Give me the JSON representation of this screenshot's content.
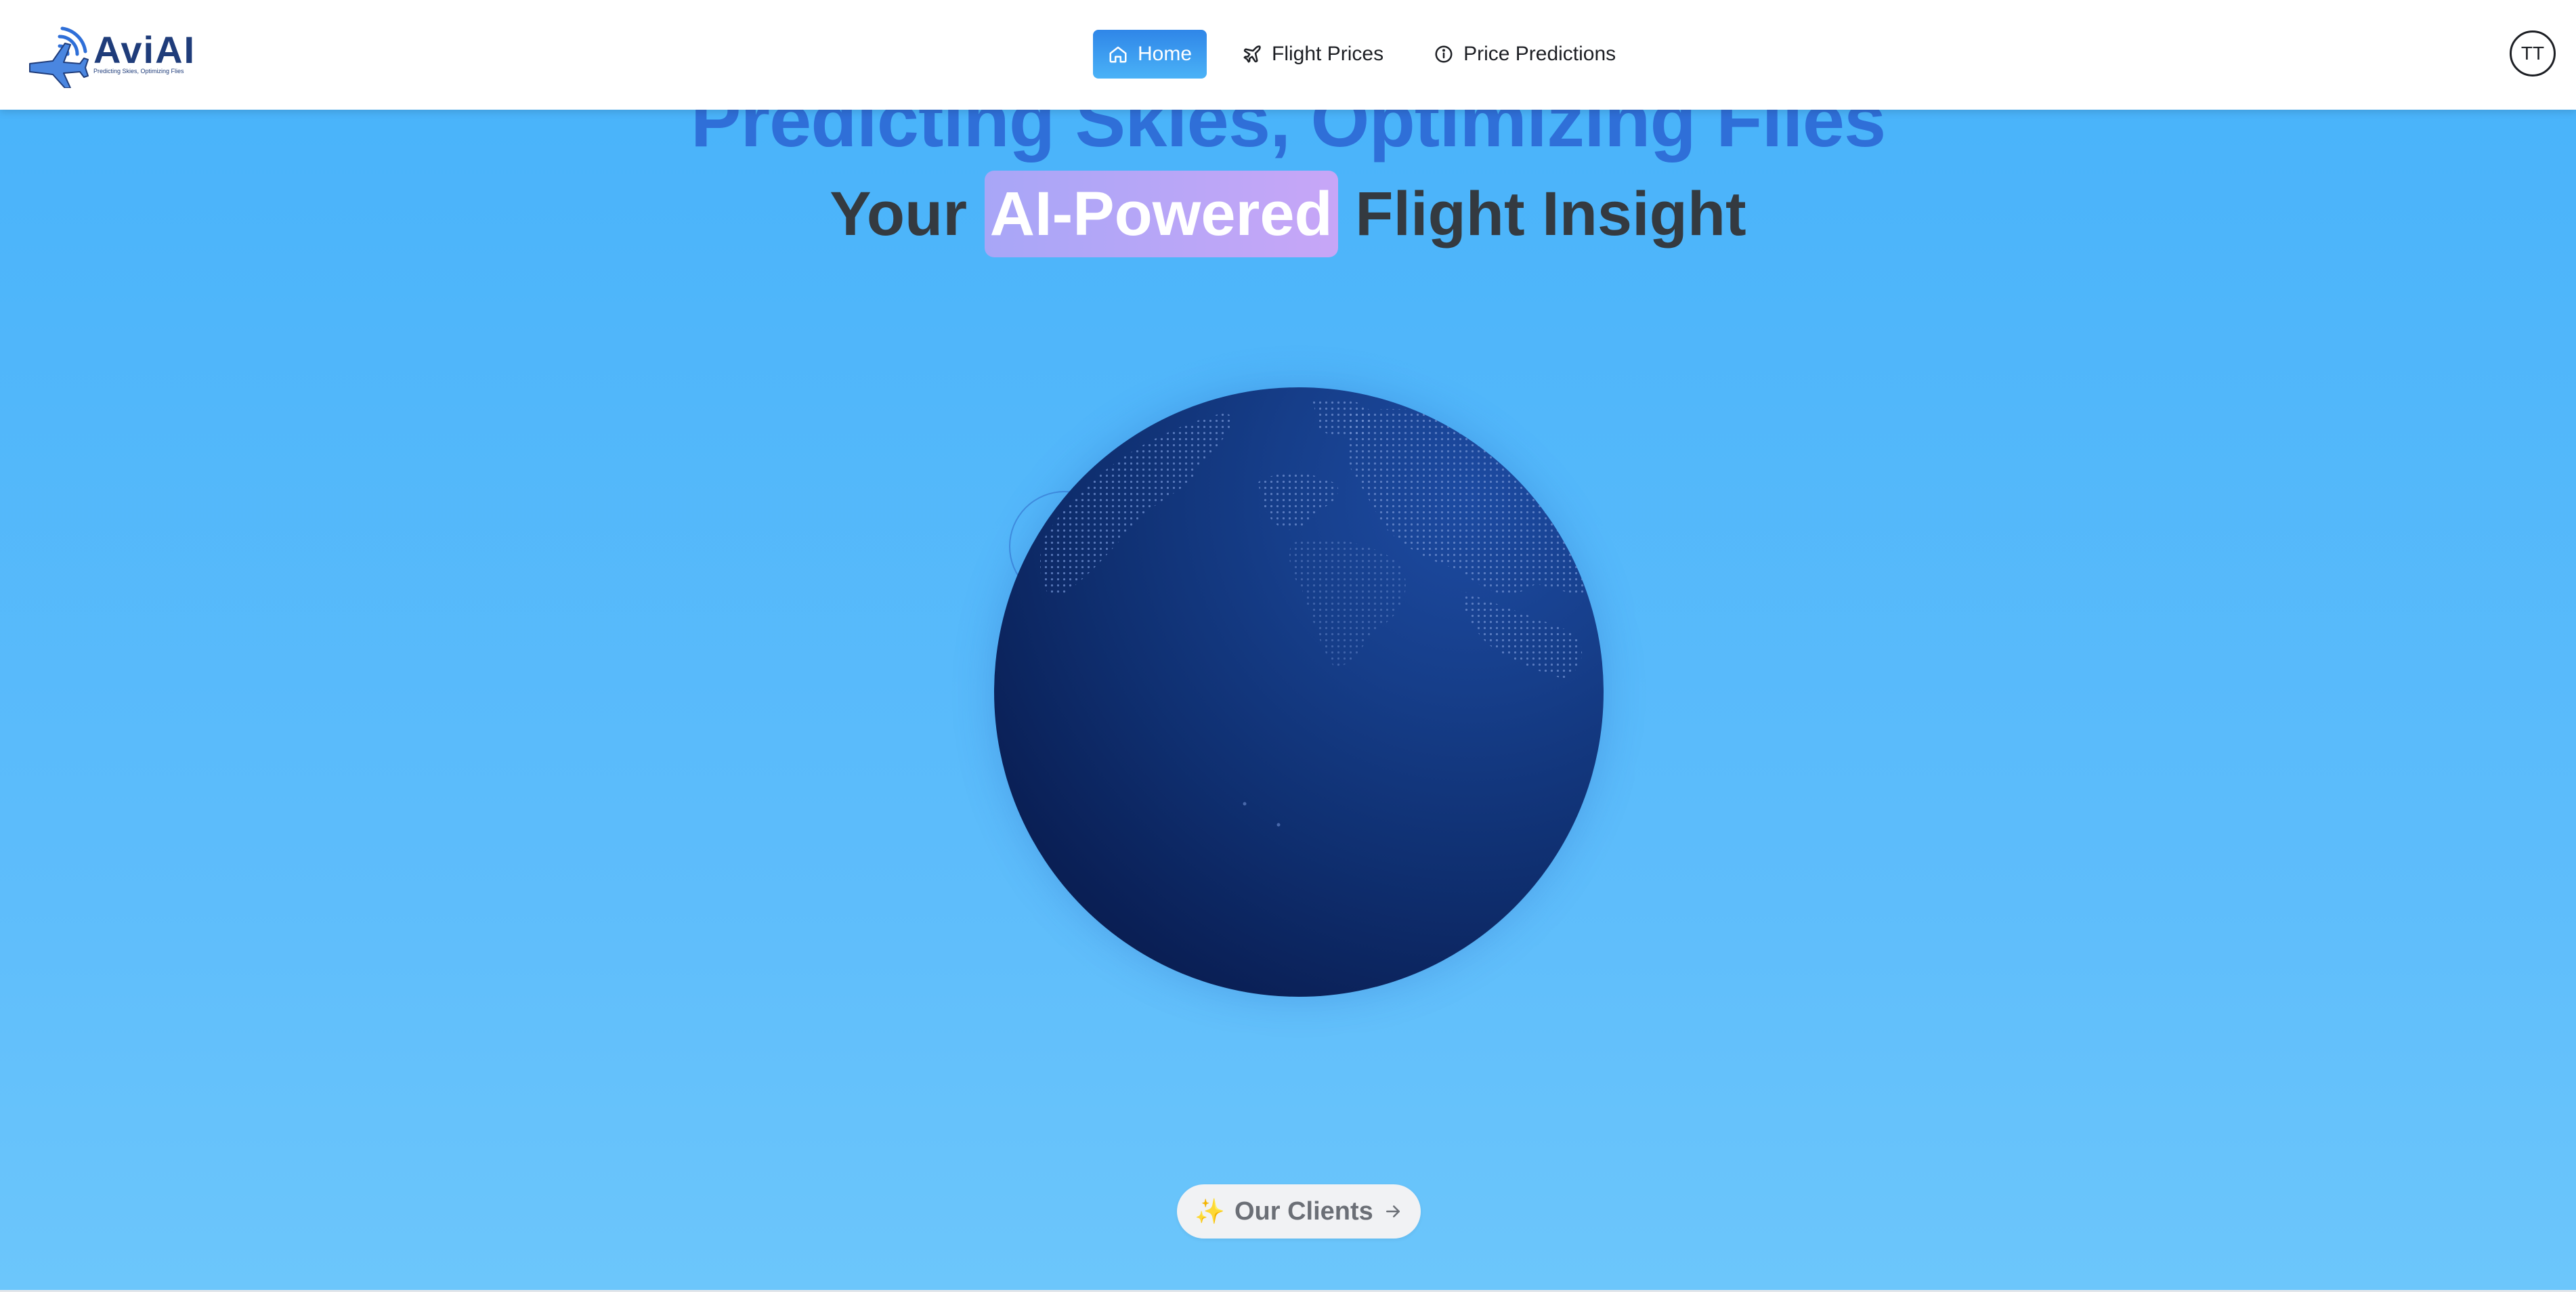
{
  "brand": {
    "name": "AviAI",
    "tagline": "Predicting Skies, Optimizing Flies"
  },
  "nav": {
    "items": [
      {
        "label": "Home",
        "icon": "home-icon",
        "active": true
      },
      {
        "label": "Flight Prices",
        "icon": "plane-icon",
        "active": false
      },
      {
        "label": "Price Predictions",
        "icon": "info-icon",
        "active": false
      }
    ]
  },
  "user": {
    "initials": "TT"
  },
  "hero": {
    "headline": "Predicting Skies, Optimizing Flies",
    "subheadline_prefix": "Your",
    "subheadline_highlight": "AI-Powered",
    "subheadline_suffix": "Flight Insight",
    "cta_icon": "sparkles-icon",
    "cta_sparkle": "✨",
    "cta_label": "Our Clients",
    "cta_arrow_icon": "arrow-right-icon"
  },
  "colors": {
    "accent": "#2f86e8",
    "headline": "#2f6fd8",
    "highlight": "#b4a6f7",
    "globe": "#0f2f70",
    "background": "#5ebdfb"
  }
}
